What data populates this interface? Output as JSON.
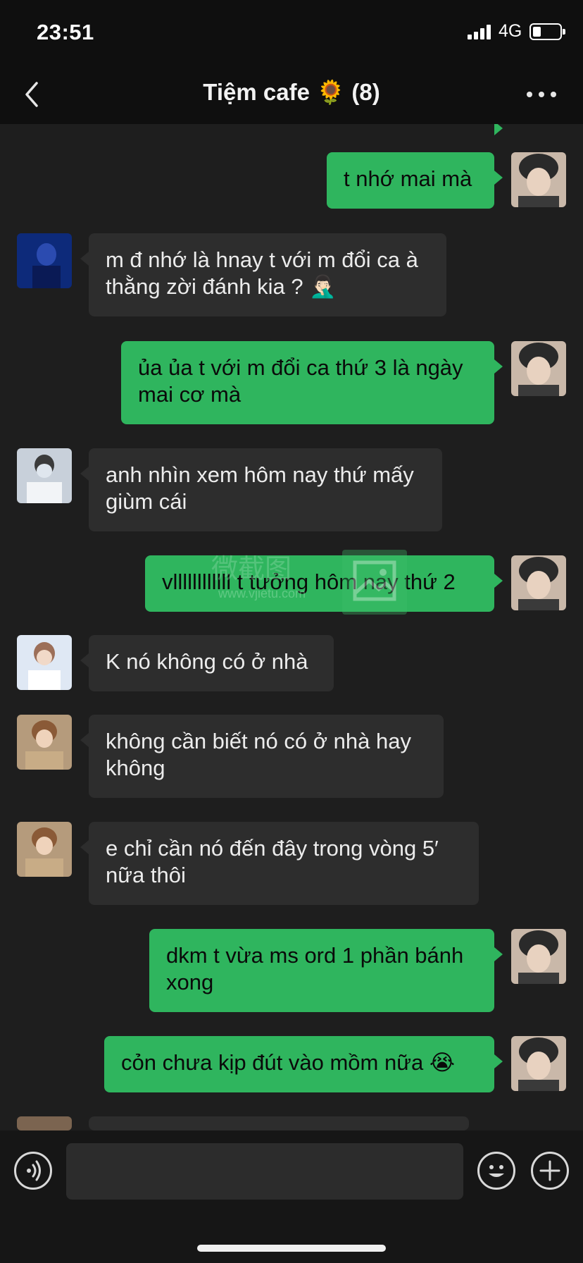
{
  "status_bar": {
    "time": "23:51",
    "network": "4G",
    "battery_level": 0.3
  },
  "nav": {
    "title": "Tiệm cafe 🌻 (8)"
  },
  "messages": [
    {
      "side": "out",
      "text": "t nhớ mai mà"
    },
    {
      "side": "in",
      "text": "m đ nhớ là hnay t với m đổi ca à thằng zời đánh kia ? 🤦🏻‍♂️"
    },
    {
      "side": "out",
      "text": "ủa ủa t với m đổi ca thứ 3 là ngày mai cơ mà"
    },
    {
      "side": "in",
      "text": "anh nhìn xem hôm nay thứ mấy giùm cái"
    },
    {
      "side": "out",
      "text": "vllllllllllll t tưởng hôm nay thứ 2"
    },
    {
      "side": "in",
      "text": "K nó không có ở nhà"
    },
    {
      "side": "in",
      "text": "không cần biết nó có ở nhà hay không"
    },
    {
      "side": "in",
      "text": "e chỉ cần nó đến đây trong vòng 5′ nữa thôi"
    },
    {
      "side": "out",
      "text": "dkm t vừa ms ord 1 phần bánh xong"
    },
    {
      "side": "out",
      "text": "cỏn chưa kịp đút vào mồm nữa 😭"
    }
  ],
  "watermark": {
    "text": "微截图",
    "url": "www.vjietu.com"
  },
  "icons": {
    "back": "chevron-left-icon",
    "more": "more-dots-icon",
    "voice": "voice-icon",
    "emoji": "emoji-icon",
    "plus": "plus-icon"
  },
  "colors": {
    "outgoing_bubble": "#2fb55e",
    "incoming_bubble": "#2d2d2d",
    "chat_background": "#1e1e1e",
    "bar_background": "#0f0f0f"
  }
}
